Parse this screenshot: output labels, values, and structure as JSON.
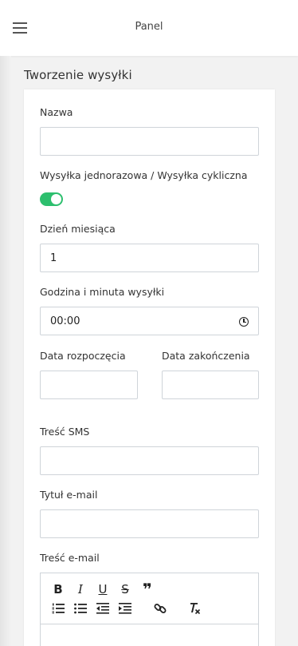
{
  "header": {
    "title": "Panel"
  },
  "page": {
    "heading": "Tworzenie wysyłki"
  },
  "form": {
    "name_label": "Nazwa",
    "name_value": "",
    "type_label": "Wysyłka jednorazowa / Wysyłka cykliczna",
    "type_toggle_on": true,
    "day_label": "Dzień miesiąca",
    "day_value": "1",
    "time_label": "Godzina i minuta wysyłki",
    "time_value": "00:00",
    "start_label": "Data rozpoczęcia",
    "start_value": "",
    "end_label": "Data zakończenia",
    "end_value": "",
    "sms_label": "Treść SMS",
    "sms_value": "",
    "email_title_label": "Tytuł e-mail",
    "email_title_value": "",
    "email_body_label": "Treść e-mail",
    "editor_toolbar": {
      "bold": "B",
      "italic": "I",
      "underline": "U",
      "strike": "S",
      "quote": "❞"
    }
  },
  "colors": {
    "toggle_on": "#2dbf6e",
    "page_bg": "#f2f2f2",
    "border": "#cfd4d9"
  }
}
